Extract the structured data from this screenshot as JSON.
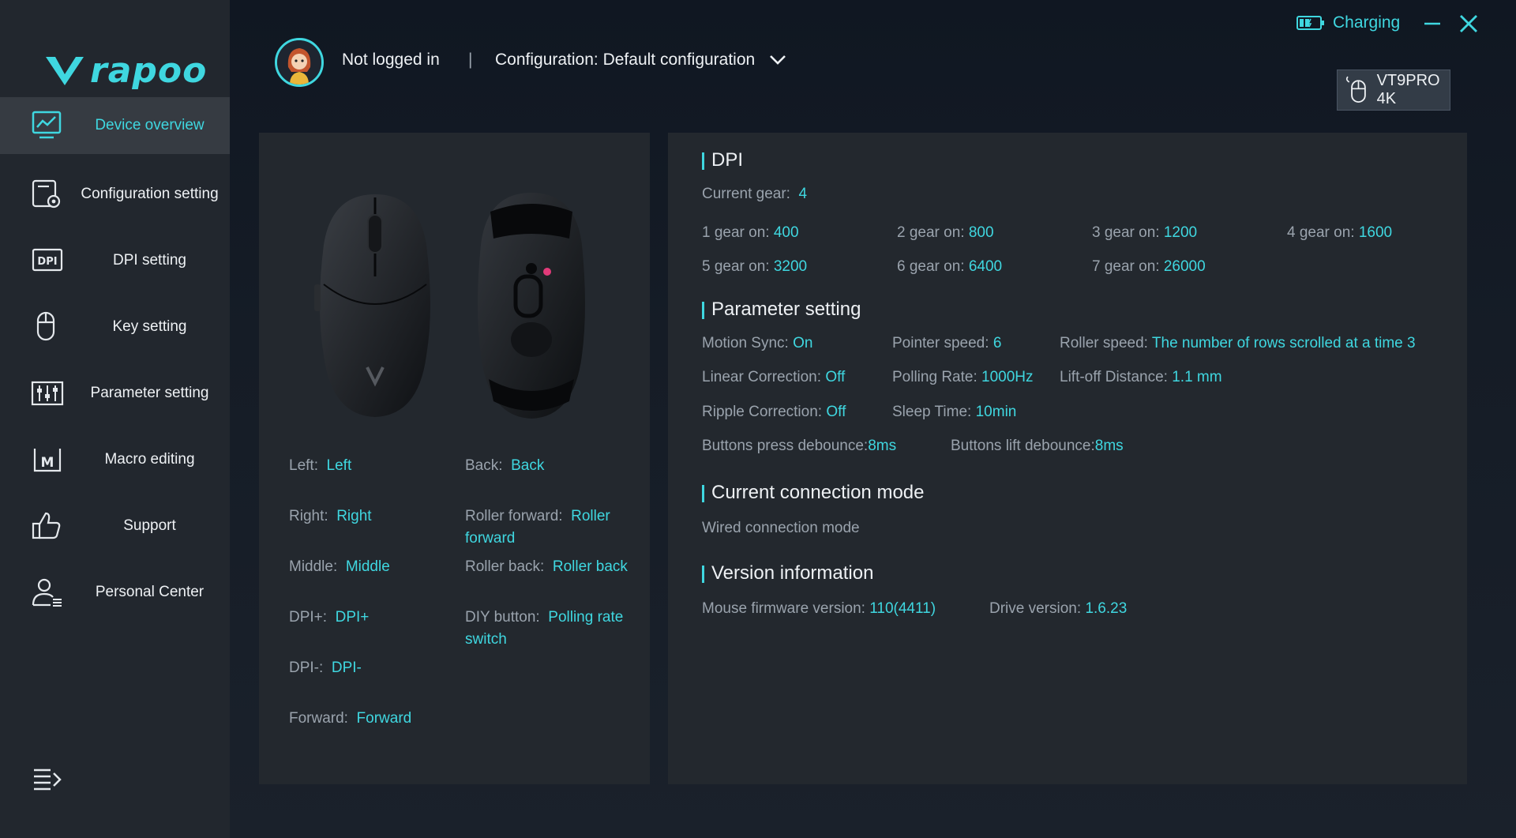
{
  "brand": {
    "logo_text": "rapoo",
    "logo_color": "#3fd7e0"
  },
  "colors": {
    "accent": "#3fd7e0",
    "sidebar_bg": "#22272e",
    "panel_bg": "#23282e",
    "active_item_bg": "#363b42"
  },
  "sidebar": {
    "items": [
      {
        "label": "Device overview",
        "icon": "chart-monitor-icon",
        "active": true
      },
      {
        "label": "Configuration setting",
        "icon": "config-gear-icon"
      },
      {
        "label": "DPI setting",
        "icon": "dpi-icon"
      },
      {
        "label": "Key setting",
        "icon": "mouse-icon"
      },
      {
        "label": "Parameter setting",
        "icon": "sliders-icon"
      },
      {
        "label": "Macro editing",
        "icon": "macro-icon"
      },
      {
        "label": "Support",
        "icon": "thumbs-up-icon"
      },
      {
        "label": "Personal Center",
        "icon": "person-icon"
      }
    ],
    "menu_icon": "menu-icon"
  },
  "header": {
    "login_status": "Not logged in",
    "separator": "|",
    "configuration": "Configuration: Default configuration",
    "charging_label": "Charging",
    "device_name": "VT9PRO 4K"
  },
  "keys": {
    "left": {
      "label": "Left:",
      "value": "Left"
    },
    "right": {
      "label": "Right:",
      "value": "Right"
    },
    "middle": {
      "label": "Middle:",
      "value": "Middle"
    },
    "dpi_plus": {
      "label": "DPI+:",
      "value": "DPI+"
    },
    "dpi_minus": {
      "label": "DPI-:",
      "value": "DPI-"
    },
    "forward": {
      "label": "Forward:",
      "value": "Forward"
    },
    "back": {
      "label": "Back:",
      "value": "Back"
    },
    "roller_forward": {
      "label": "Roller forward:",
      "value": "Roller forward"
    },
    "roller_back": {
      "label": "Roller back:",
      "value": "Roller back"
    },
    "diy": {
      "label": "DIY button:",
      "value": "Polling rate switch"
    }
  },
  "dpi": {
    "title": "DPI",
    "current_label": "Current gear:",
    "current_value": "4",
    "gears": [
      {
        "label": "1 gear on:",
        "value": "400"
      },
      {
        "label": "2 gear on:",
        "value": "800"
      },
      {
        "label": "3 gear on:",
        "value": "1200"
      },
      {
        "label": "4 gear on:",
        "value": "1600"
      },
      {
        "label": "5 gear on:",
        "value": "3200"
      },
      {
        "label": "6 gear on:",
        "value": "6400"
      },
      {
        "label": "7 gear on:",
        "value": "26000"
      }
    ]
  },
  "params": {
    "title": "Parameter setting",
    "motion_sync": {
      "label": "Motion Sync:",
      "value": "On"
    },
    "pointer_speed": {
      "label": "Pointer speed:",
      "value": "6"
    },
    "roller_speed": {
      "label": "Roller speed:",
      "value": "The number of rows scrolled at a time 3"
    },
    "linear_correction": {
      "label": "Linear Correction:",
      "value": "Off"
    },
    "polling_rate": {
      "label": "Polling Rate:",
      "value": "1000Hz"
    },
    "liftoff": {
      "label": "Lift-off Distance:",
      "value": "1.1 mm"
    },
    "ripple_correction": {
      "label": "Ripple Correction:",
      "value": "Off"
    },
    "sleep_time": {
      "label": "Sleep Time:",
      "value": "10min"
    },
    "press_debounce": {
      "label": "Buttons press debounce:",
      "value": "8ms"
    },
    "lift_debounce": {
      "label": "Buttons lift debounce:",
      "value": "8ms"
    }
  },
  "connection": {
    "title": "Current connection mode",
    "mode": "Wired connection mode"
  },
  "version": {
    "title": "Version information",
    "firmware": {
      "label": "Mouse firmware version:",
      "value": "110(4411)"
    },
    "drive": {
      "label": "Drive version:",
      "value": "1.6.23"
    }
  }
}
